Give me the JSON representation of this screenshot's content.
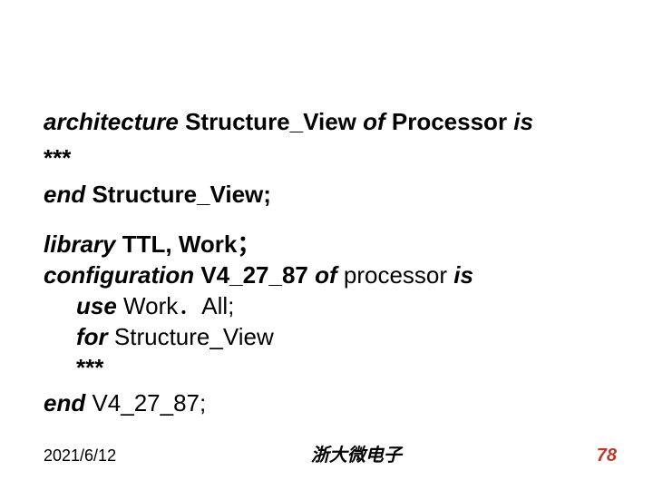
{
  "lines": {
    "l1a": "architecture",
    "l1b": " Structure_View ",
    "l1c": "of",
    "l1d": " Processor ",
    "l1e": "is",
    "l2": "***",
    "l3a": "end",
    "l3b": " Structure_View;",
    "l4a": "library",
    "l4b": " TTL, Work；",
    "l5a": "configuration",
    "l5b": " V4_27_87 ",
    "l5c": "of",
    "l5d": " processor ",
    "l5e": "is",
    "l6a": "use",
    "l6b": " Work．All;",
    "l7a": "for",
    "l7b": " Structure_View",
    "l8": "***",
    "l9a": "end",
    "l9b": " V4_27_87;"
  },
  "footer": {
    "date": "2021/6/12",
    "center": "浙大微电子",
    "page": "78"
  }
}
